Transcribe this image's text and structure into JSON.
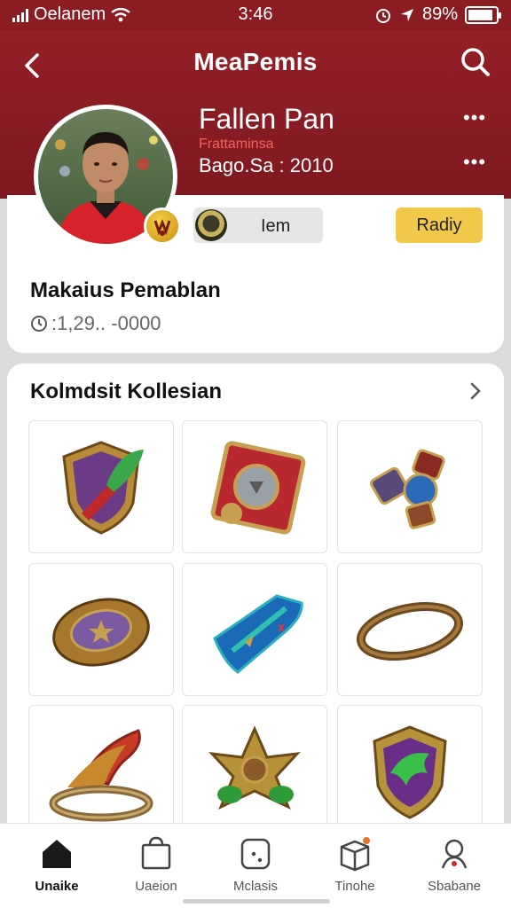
{
  "status_bar": {
    "carrier": "Oelanem",
    "time": "3:46",
    "battery": "89%",
    "battery_level": 0.89
  },
  "header": {
    "title": "MeaPemis"
  },
  "profile": {
    "name": "Fallen Pan",
    "subtitle": "Frattaminsa",
    "meta": "Bago.Sa  :  2010",
    "item_chip_label": "Iem",
    "ready_label": "Radiy",
    "section_title": "Makaius Pemablan",
    "stat_value": ":1,29.. -0000"
  },
  "collection": {
    "title": "Kolmdsit Kollesian",
    "items": [
      {
        "name": "leaf-shield-emblem"
      },
      {
        "name": "crest-tome"
      },
      {
        "name": "crossed-hammers"
      },
      {
        "name": "bronze-medallion"
      },
      {
        "name": "blue-cape"
      },
      {
        "name": "bronze-ring"
      },
      {
        "name": "claw-ring"
      },
      {
        "name": "star-leaf-emblem"
      },
      {
        "name": "dragon-shield"
      }
    ]
  },
  "tabs": [
    {
      "label": "Unaike",
      "icon": "home-icon",
      "active": true
    },
    {
      "label": "Uaeion",
      "icon": "bag-icon",
      "active": false
    },
    {
      "label": "Mclasis",
      "icon": "device-icon",
      "active": false
    },
    {
      "label": "Tinohe",
      "icon": "box-icon",
      "active": false
    },
    {
      "label": "Sbabane",
      "icon": "profile-icon",
      "active": false
    }
  ],
  "colors": {
    "header": "#8a1c22",
    "ready": "#f1c84a",
    "background": "#dcdcdc"
  }
}
